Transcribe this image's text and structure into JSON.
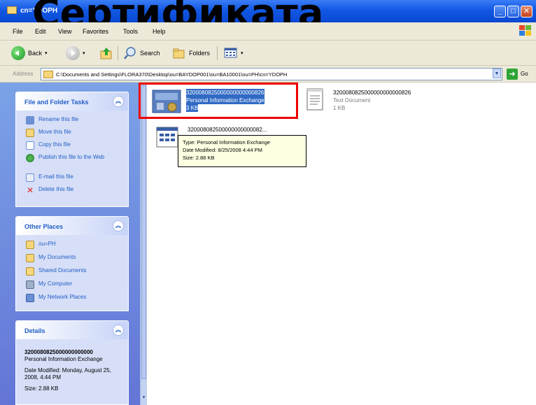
{
  "window": {
    "title": "cn=YDOPH",
    "overlay_title": "Сертификата",
    "buttons": {
      "minimize": "_",
      "maximize": "□",
      "close": "✕"
    }
  },
  "menu": [
    "File",
    "Edit",
    "View",
    "Favorites",
    "Tools",
    "Help"
  ],
  "toolbar": {
    "back": "Back",
    "search": "Search",
    "folders": "Folders"
  },
  "address": {
    "label": "Address",
    "value": "C:\\Documents and Settings\\FLORA370\\Desktop\\ou=BAYDOP001\\ou=BA10001\\ou=PH\\cn=YDOPH",
    "go": "Go"
  },
  "file_tasks": {
    "title": "File and Folder Tasks",
    "items": [
      {
        "label": "Rename this file",
        "icon": "rename-icon"
      },
      {
        "label": "Move this file",
        "icon": "move-icon"
      },
      {
        "label": "Copy this file",
        "icon": "copy-icon"
      },
      {
        "label": "Publish this file to the Web",
        "icon": "publish-icon"
      },
      {
        "label": "E-mail this file",
        "icon": "email-icon"
      },
      {
        "label": "Delete this file",
        "icon": "delete-icon"
      }
    ]
  },
  "other_places": {
    "title": "Other Places",
    "items": [
      {
        "label": "ou=PH",
        "icon": "folder-icon"
      },
      {
        "label": "My Documents",
        "icon": "my-documents-icon"
      },
      {
        "label": "Shared Documents",
        "icon": "shared-documents-icon"
      },
      {
        "label": "My Computer",
        "icon": "my-computer-icon"
      },
      {
        "label": "My Network Places",
        "icon": "network-icon"
      }
    ]
  },
  "details": {
    "title": "Details",
    "name": "3200080825000000000000",
    "type": "Personal Information Exchange",
    "modified": "Date Modified: Monday, August 25, 2008, 4:44 PM",
    "size": "Size: 2.88 KB"
  },
  "files": [
    {
      "name": "3200080825000000000000826",
      "type": "Personal Information Exchange",
      "size": "3 KB",
      "selected": true
    },
    {
      "name": "3200080825000000000000826",
      "type": "Text Document",
      "size": "1 KB",
      "selected": false
    },
    {
      "name": "320008082500000000000082..."
    }
  ],
  "tooltip": {
    "type": "Type: Personal Information Exchange",
    "modified": "Date Modified: 8/25/2008 4:44 PM",
    "size": "Size: 2.88 KB"
  },
  "colors": {
    "selection": "#316ac5",
    "highlight_box": "#ee0000",
    "task_link": "#215dc6"
  }
}
